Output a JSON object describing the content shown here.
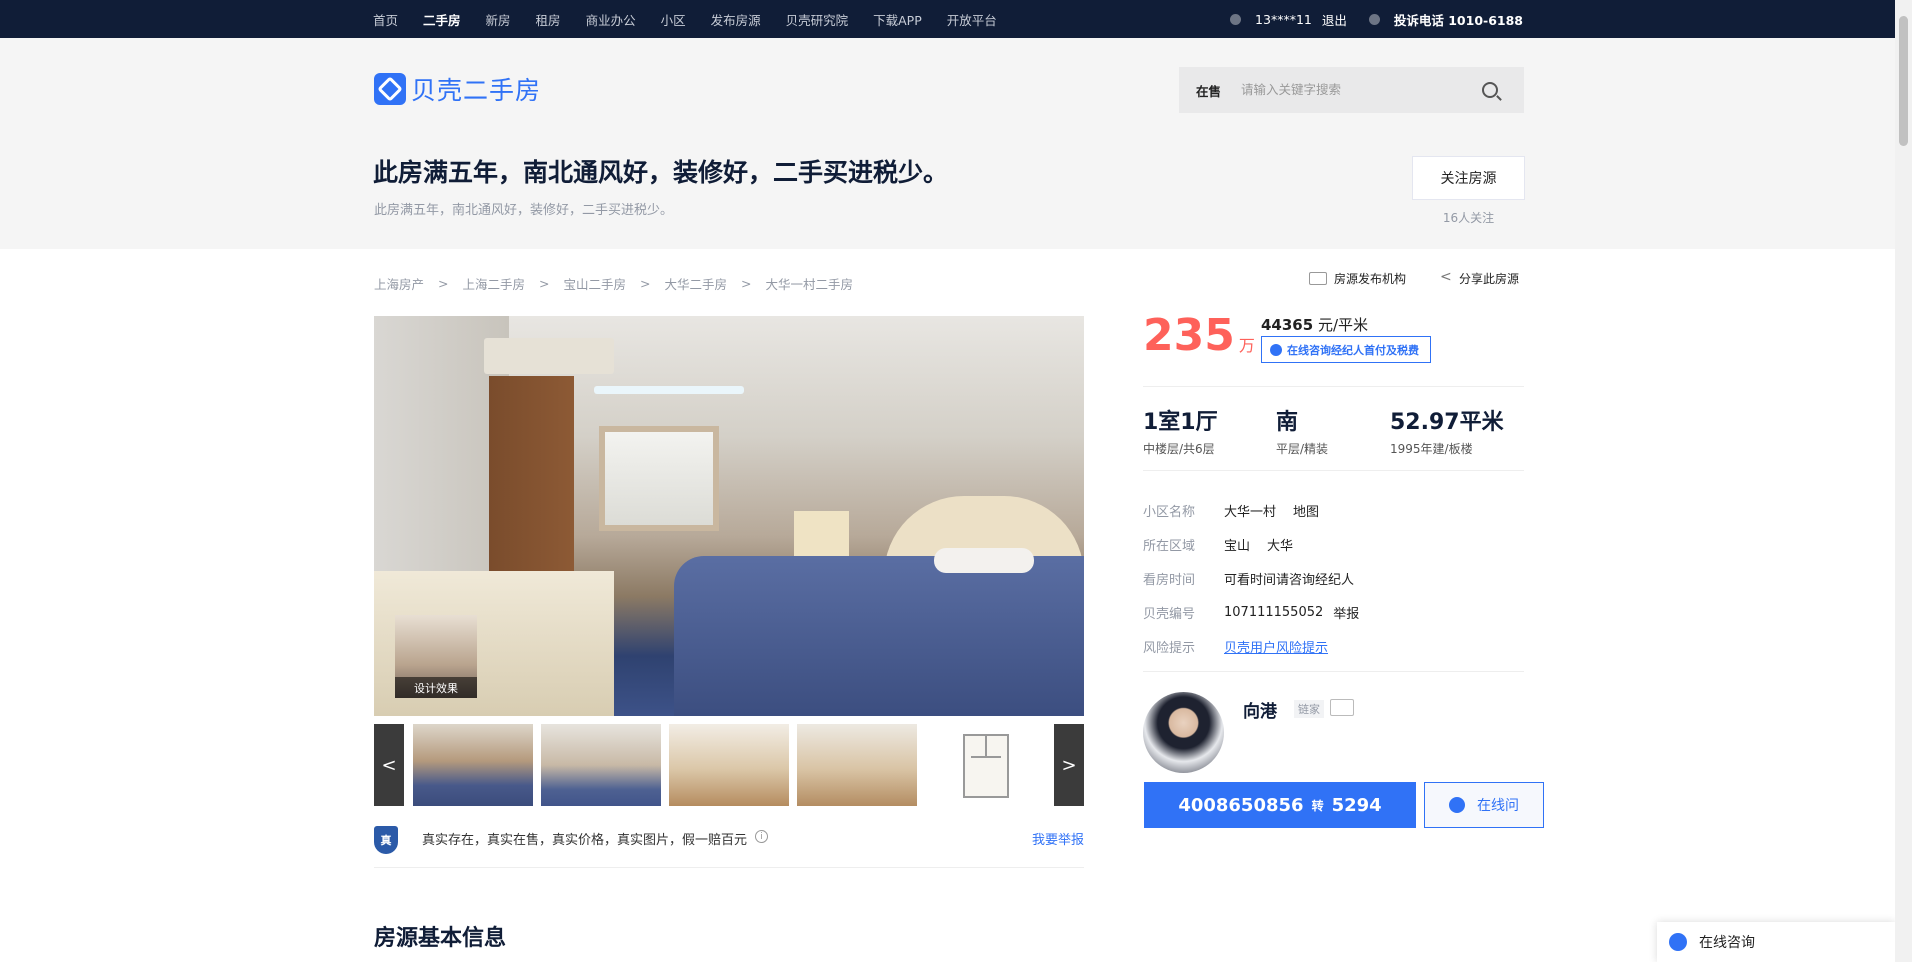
{
  "topnav": {
    "links": [
      "首页",
      "二手房",
      "新房",
      "租房",
      "商业办公",
      "小区",
      "发布房源",
      "贝壳研究院",
      "下载APP",
      "开放平台"
    ],
    "active_index": 1,
    "user": "13****11",
    "logout": "退出",
    "complaint_phone": "投诉电话 1010-6188"
  },
  "header": {
    "logo_text": "贝壳二手房",
    "search_tag": "在售",
    "search_placeholder": "请输入关键字搜索",
    "title": "此房满五年，南北通风好，装修好，二手买进税少。",
    "subtitle": "此房满五年，南北通风好，装修好，二手买进税少。",
    "follow_button": "关注房源",
    "follow_count": "16人关注"
  },
  "breadcrumb": [
    "上海房产",
    "上海二手房",
    "宝山二手房",
    "大华二手房",
    "大华一村二手房"
  ],
  "top_links": {
    "agency": "房源发布机构",
    "share": "分享此房源"
  },
  "gallery": {
    "design_label": "设计效果",
    "prev": "<",
    "next": ">"
  },
  "guarantee": {
    "badge": "真",
    "text": "真实存在，真实在售，真实价格，真实图片，假一赔百元",
    "report": "我要举报"
  },
  "section_title": "房源基本信息",
  "price": {
    "total": "235",
    "total_unit": "万",
    "unit_price": "44365",
    "unit_price_suffix": " 元/平米",
    "consult_tag": "在线咨询经纪人首付及税费"
  },
  "stats": [
    {
      "main": "1室1厅",
      "sub": "中楼层/共6层"
    },
    {
      "main": "南",
      "sub": "平层/精装"
    },
    {
      "main": "52.97平米",
      "sub": "1995年建/板楼"
    }
  ],
  "info": [
    {
      "k": "小区名称",
      "v": "大华一村",
      "v2": "地图"
    },
    {
      "k": "所在区域",
      "v": "宝山",
      "v2": "大华"
    },
    {
      "k": "看房时间",
      "v": "可看时间请咨询经纪人",
      "v2": ""
    },
    {
      "k": "贝壳编号",
      "v": "107111155052",
      "v2": "举报"
    },
    {
      "k": "风险提示",
      "v": "贝壳用户风险提示",
      "v2": ""
    }
  ],
  "agent": {
    "name": "向港",
    "brand": "链家",
    "phone": "4008650856",
    "zhuan": "转",
    "ext": "5294",
    "online": "在线问"
  },
  "float_consult": "在线咨询",
  "colors": {
    "nav_bg": "#101d37",
    "brand_blue": "#3072f6",
    "price_red": "#fe615a",
    "header_bg": "#f5f5f5"
  }
}
